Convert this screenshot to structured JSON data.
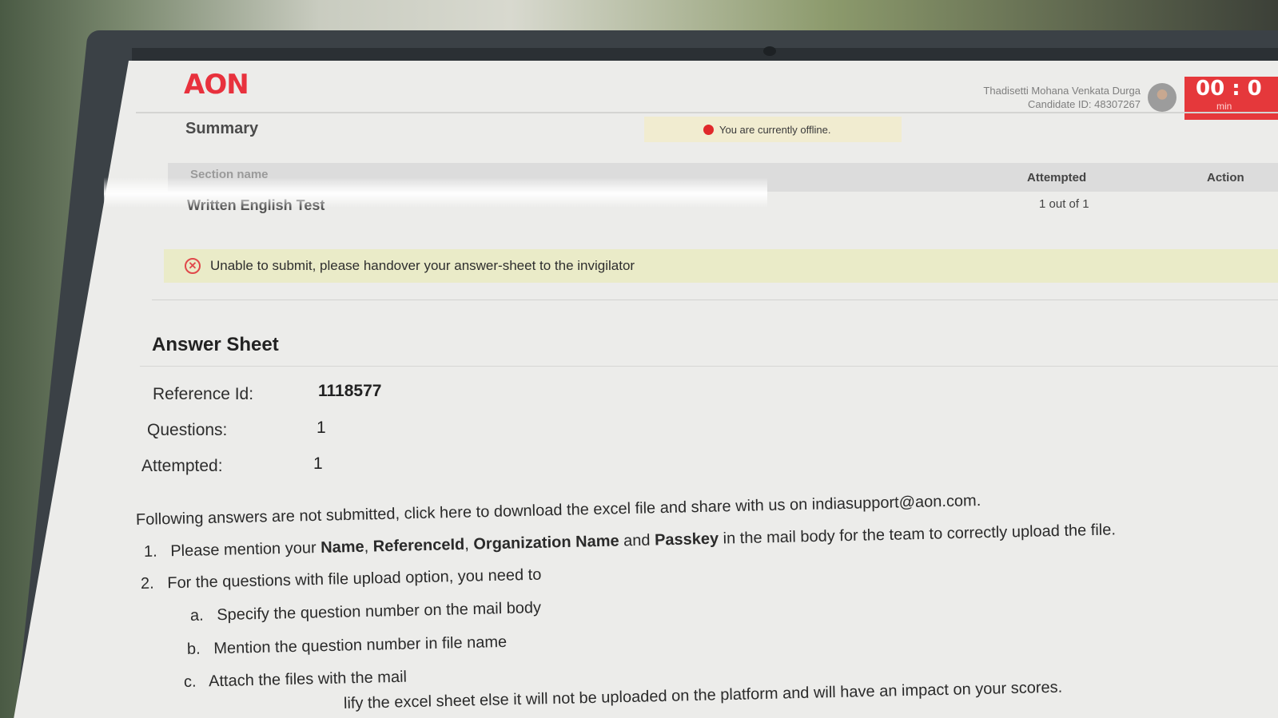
{
  "header": {
    "logo": "AON",
    "candidate_name": "Thadisetti Mohana Venkata Durga",
    "candidate_id": "Candidate ID: 48307267",
    "timer_value": "00 : 0",
    "timer_unit": "min"
  },
  "summary": {
    "title": "Summary",
    "offline_message": "You are currently offline.",
    "columns": {
      "section": "Section name",
      "attempted": "Attempted",
      "action": "Action"
    },
    "rows": [
      {
        "section": "Written English Test",
        "attempted": "1 out of 1"
      }
    ],
    "error_message": "Unable to submit, please handover your answer-sheet to the invigilator"
  },
  "answer_sheet": {
    "title": "Answer Sheet",
    "reference_label": "Reference Id:",
    "reference_value": "1118577",
    "questions_label": "Questions:",
    "questions_value": "1",
    "attempted_label": "Attempted:",
    "attempted_value": "1",
    "intro": "Following answers are not submitted, click here to download the excel file and share with us on indiasupport@aon.com.",
    "item1_num": "1.",
    "item1_pre": "Please mention your ",
    "item1_name": "Name",
    "item1_sep1": ", ",
    "item1_ref": "ReferenceId",
    "item1_sep2": ", ",
    "item1_org": "Organization Name",
    "item1_and": " and ",
    "item1_pass": "Passkey",
    "item1_post": " in the mail body for the team to correctly upload the file.",
    "item2_num": "2.",
    "item2_text": "For the questions with file upload option, you need to",
    "sub_a_letter": "a.",
    "sub_a_text": "Specify the question number on the mail body",
    "sub_b_letter": "b.",
    "sub_b_text": "Mention the question number in file name",
    "sub_c_letter": "c.",
    "sub_c_text": "Attach the files with the mail",
    "footer_partial": "lify the excel sheet else it will not be uploaded on the platform and will have an impact on your scores."
  }
}
